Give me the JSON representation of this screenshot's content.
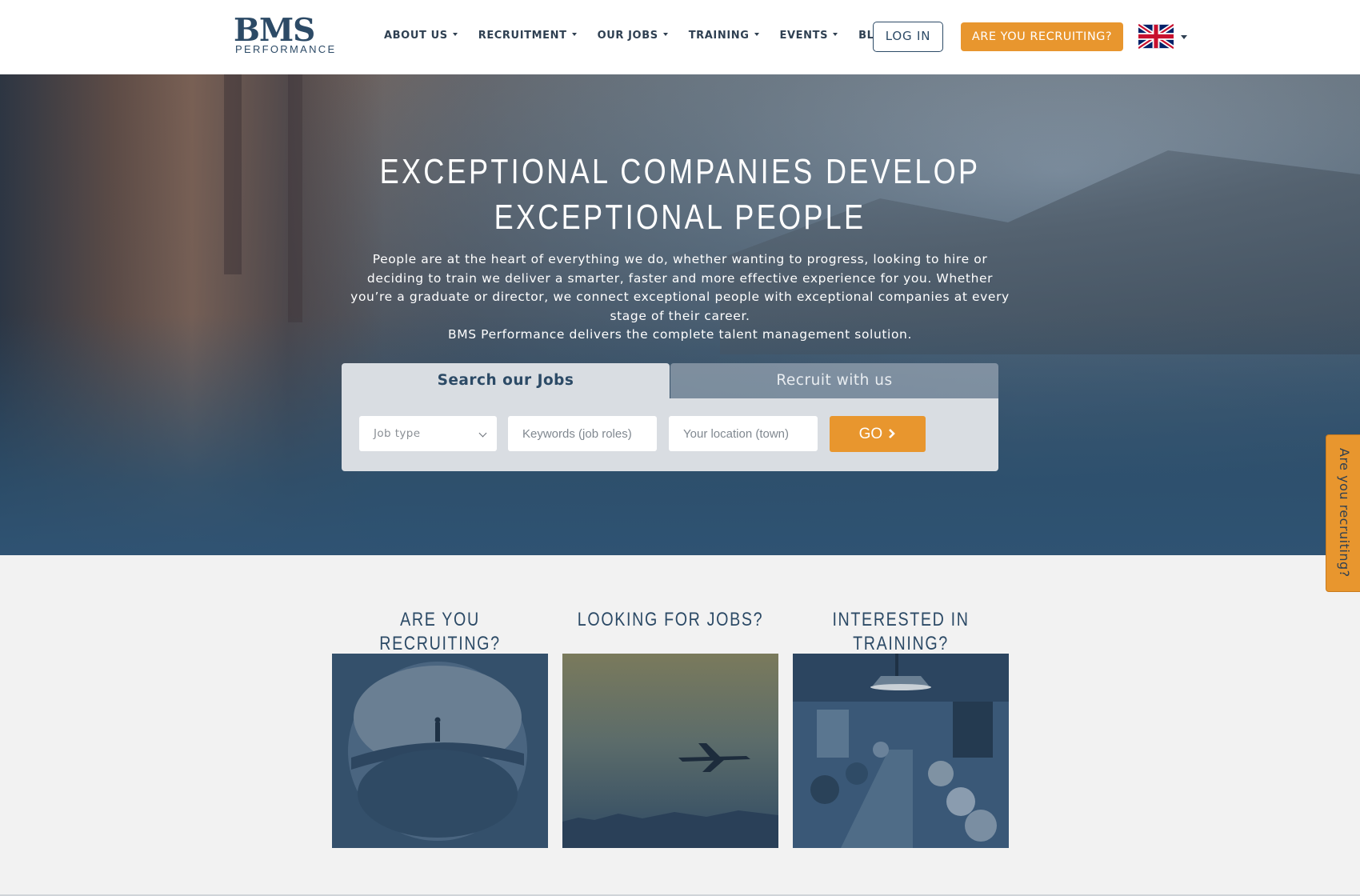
{
  "brand": {
    "name": "BMS",
    "sub": "PERFORMANCE"
  },
  "nav": {
    "items": [
      {
        "label": "ABOUT US",
        "dropdown": true
      },
      {
        "label": "RECRUITMENT",
        "dropdown": true
      },
      {
        "label": "OUR JOBS",
        "dropdown": true
      },
      {
        "label": "TRAINING",
        "dropdown": true
      },
      {
        "label": "EVENTS",
        "dropdown": true
      },
      {
        "label": "BLOG",
        "dropdown": false
      }
    ],
    "login_label": "LOG IN",
    "recruit_label": "ARE YOU RECRUITING?",
    "language_flag": "uk-flag-icon"
  },
  "hero": {
    "title_line1": "EXCEPTIONAL COMPANIES DEVELOP",
    "title_line2": "EXCEPTIONAL PEOPLE",
    "body": "People are at the heart of everything we do, whether wanting to progress, looking to hire or deciding to train we deliver a smarter, faster and more effective experience for you. Whether you’re a graduate or director, we connect exceptional people with exceptional companies at every stage of their career.",
    "tagline": "BMS Performance delivers the complete talent management solution."
  },
  "search": {
    "tab_active": "Search our Jobs",
    "tab_inactive": "Recruit with us",
    "job_type_placeholder": "Job type",
    "keywords_placeholder": "Keywords (job roles)",
    "location_placeholder": "Your location (town)",
    "go_label": "GO"
  },
  "side_tab": {
    "label": "Are you recruiting?"
  },
  "cards": [
    {
      "title": "ARE YOU RECRUITING?"
    },
    {
      "title": "LOOKING FOR JOBS?"
    },
    {
      "title": "INTERESTED IN TRAINING?"
    }
  ],
  "colors": {
    "brand_navy": "#2c4a66",
    "accent_orange": "#e8962e",
    "page_bg": "#f2f2f2"
  }
}
